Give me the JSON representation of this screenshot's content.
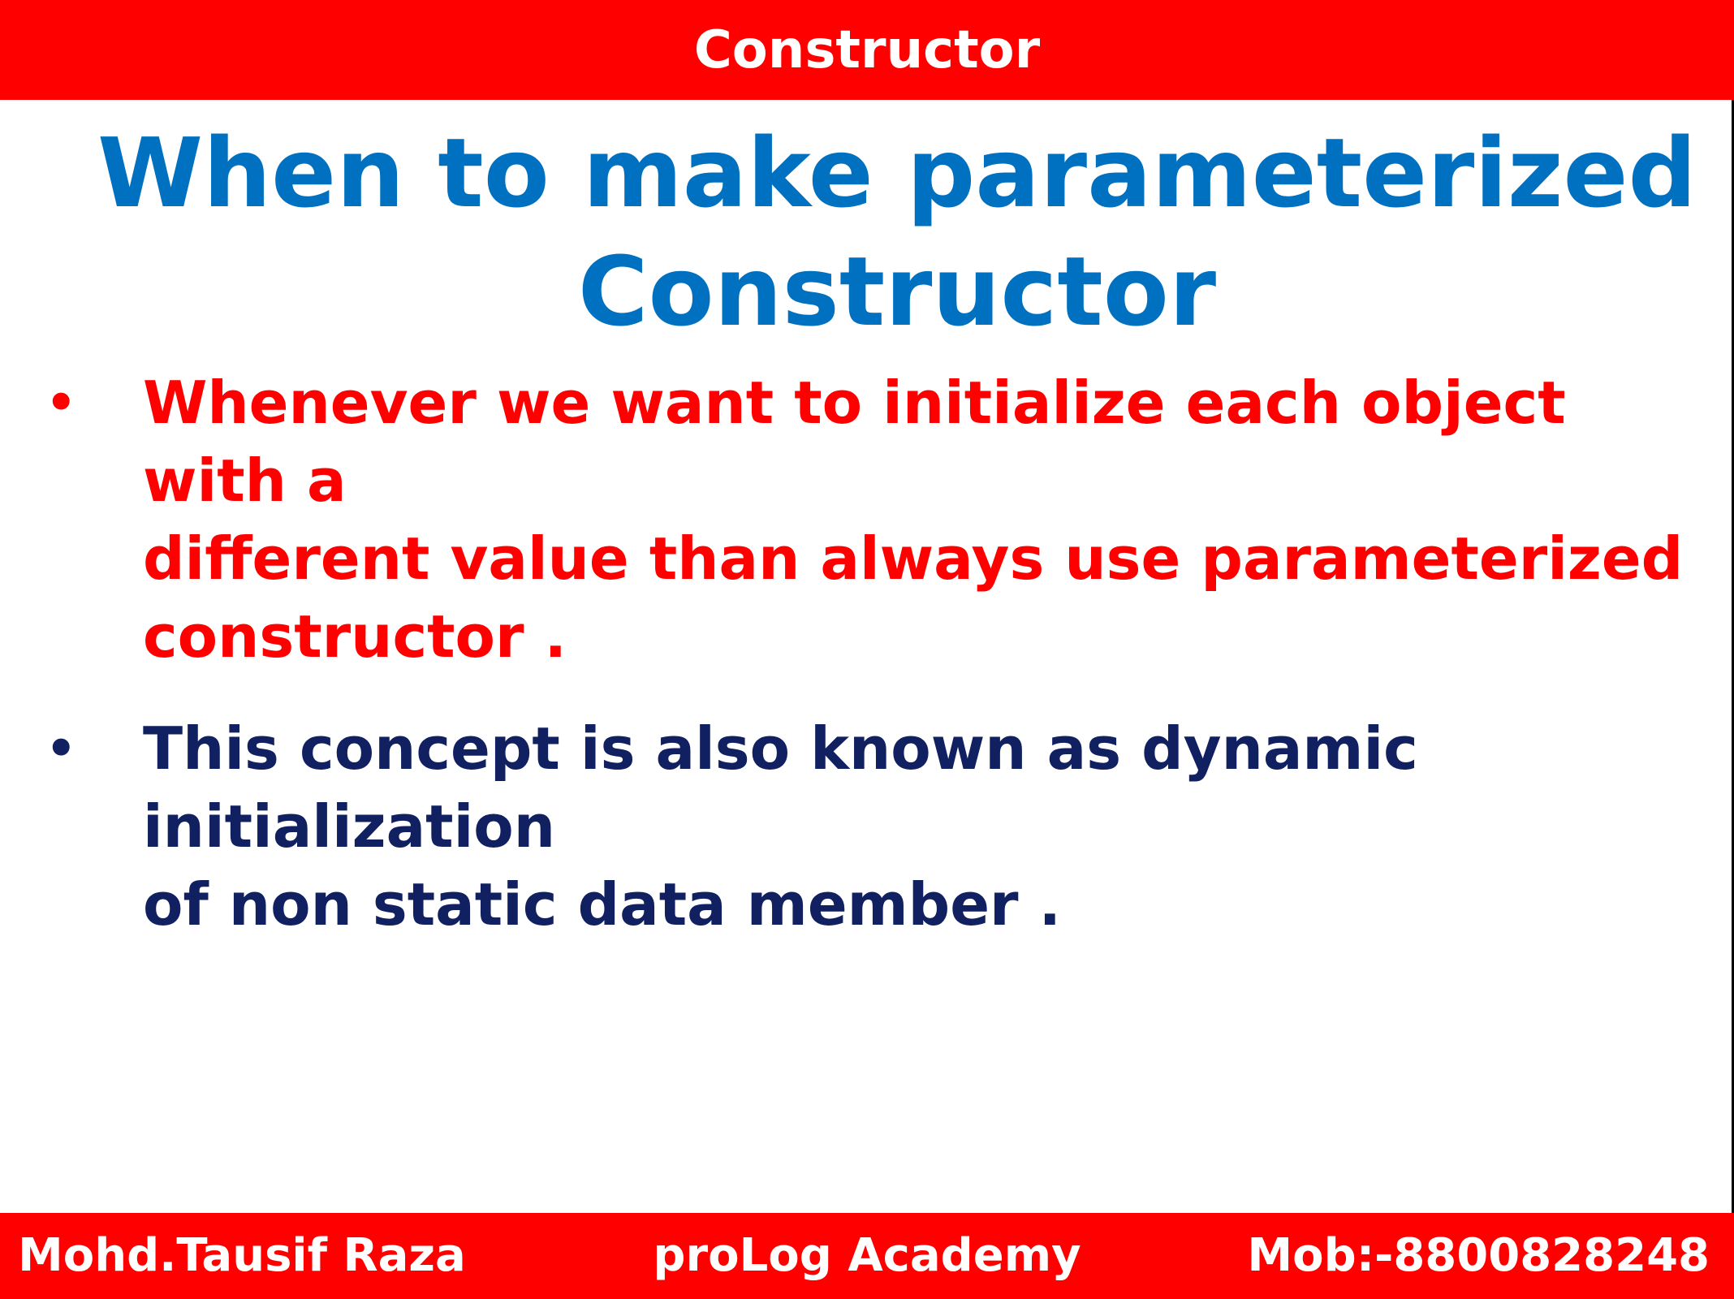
{
  "header": {
    "title": "Constructor",
    "background": "#ff0000"
  },
  "main": {
    "title": "When to make parameterized\nConstructor",
    "title_color": "#0070c0",
    "bullets": [
      {
        "text": "Whenever we want to initialize each object with a\ndifferent  value than always use parameterized\nconstructor .",
        "color": "#ff0000"
      },
      {
        "text": "This concept is also known as dynamic initialization\nof non static data member .",
        "color": "#102060"
      }
    ]
  },
  "footer": {
    "author": "Mohd.Tausif Raza",
    "academy": "proLog Academy",
    "contact": "Mob:-8800828248",
    "background": "#ff0000"
  }
}
